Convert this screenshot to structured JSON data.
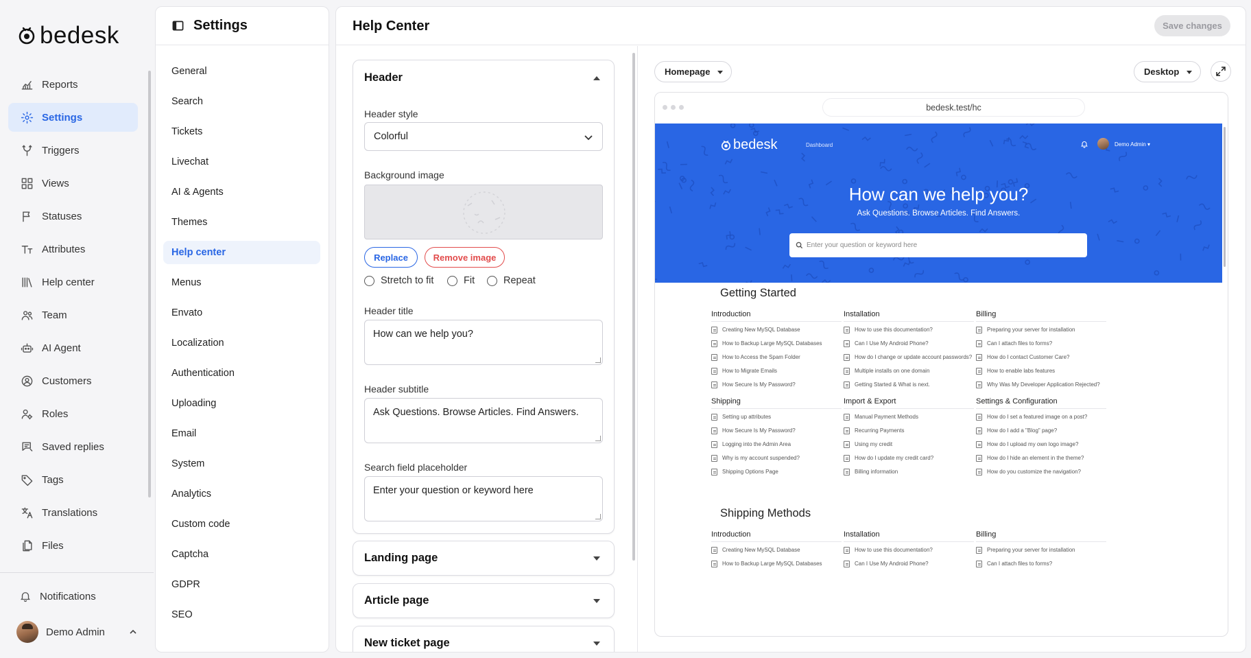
{
  "app": {
    "name": "bedesk"
  },
  "sidebar": {
    "items": [
      {
        "label": "Reports",
        "icon": "chart-icon"
      },
      {
        "label": "Settings",
        "icon": "gear-icon",
        "active": true
      },
      {
        "label": "Triggers",
        "icon": "split-icon"
      },
      {
        "label": "Views",
        "icon": "grid-icon"
      },
      {
        "label": "Statuses",
        "icon": "flag-icon"
      },
      {
        "label": "Attributes",
        "icon": "text-size-icon"
      },
      {
        "label": "Help center",
        "icon": "library-icon"
      },
      {
        "label": "Team",
        "icon": "team-icon"
      },
      {
        "label": "AI Agent",
        "icon": "robot-icon"
      },
      {
        "label": "Customers",
        "icon": "user-circle-icon"
      },
      {
        "label": "Roles",
        "icon": "user-gear-icon"
      },
      {
        "label": "Saved replies",
        "icon": "message-icon"
      },
      {
        "label": "Tags",
        "icon": "tag-icon"
      },
      {
        "label": "Translations",
        "icon": "translate-icon"
      },
      {
        "label": "Files",
        "icon": "files-icon"
      }
    ],
    "notifications": "Notifications",
    "user": "Demo Admin"
  },
  "settings": {
    "title": "Settings",
    "items": [
      "General",
      "Search",
      "Tickets",
      "Livechat",
      "AI & Agents",
      "Themes",
      "Help center",
      "Menus",
      "Envato",
      "Localization",
      "Authentication",
      "Uploading",
      "Email",
      "System",
      "Analytics",
      "Custom code",
      "Captcha",
      "GDPR",
      "SEO"
    ],
    "active": "Help center"
  },
  "main": {
    "title": "Help Center",
    "save_label": "Save changes"
  },
  "editor": {
    "header": {
      "title": "Header",
      "style_label": "Header style",
      "style_value": "Colorful",
      "bg_label": "Background image",
      "replace_label": "Replace",
      "remove_label": "Remove image",
      "fit_options": [
        "Stretch to fit",
        "Fit",
        "Repeat"
      ],
      "title_label": "Header title",
      "title_value": "How can we help you?",
      "subtitle_label": "Header subtitle",
      "subtitle_value": "Ask Questions. Browse Articles. Find Answers.",
      "placeholder_label": "Search field placeholder",
      "placeholder_value": "Enter your question or keyword here"
    },
    "collapsed": [
      "Landing page",
      "Article page",
      "New ticket page"
    ]
  },
  "preview": {
    "page_select": "Homepage",
    "device_select": "Desktop",
    "url": "bedesk.test/hc",
    "nav_link": "Dashboard",
    "user": "Demo Admin",
    "hero_title": "How can we help you?",
    "hero_subtitle": "Ask Questions. Browse Articles. Find Answers.",
    "search_placeholder": "Enter your question or keyword here",
    "accent": "#2966e4",
    "sections": [
      {
        "title": "Getting Started",
        "columns": [
          {
            "heading": "Introduction",
            "articles": [
              "Creating New MySQL Database",
              "How to Backup Large MySQL Databases",
              "How to Access the Spam Folder",
              "How to Migrate Emails",
              "How Secure Is My Password?"
            ]
          },
          {
            "heading": "Installation",
            "articles": [
              "How to use this documentation?",
              "Can I Use My Android Phone?",
              "How do I change or update account passwords?",
              "Multiple installs on one domain",
              "Getting Started & What is next."
            ]
          },
          {
            "heading": "Billing",
            "articles": [
              "Preparing your server for installation",
              "Can I attach files to forms?",
              "How do I contact Customer Care?",
              "How to enable labs features",
              "Why Was My Developer Application Rejected?"
            ]
          }
        ]
      },
      {
        "title": "",
        "columns": [
          {
            "heading": "Shipping",
            "articles": [
              "Setting up attributes",
              "How Secure Is My Password?",
              "Logging into the Admin Area",
              "Why is my account suspended?",
              "Shipping Options Page"
            ]
          },
          {
            "heading": "Import & Export",
            "articles": [
              "Manual Payment Methods",
              "Recurring Payments",
              "Using my credit",
              "How do I update my credit card?",
              "Billing information"
            ]
          },
          {
            "heading": "Settings & Configuration",
            "articles": [
              "How do I set a featured image on a post?",
              "How do I add a \"Blog\" page?",
              "How do I upload my own logo image?",
              "How do I hide an element in the theme?",
              "How do you customize the navigation?"
            ]
          }
        ]
      },
      {
        "title": "Shipping Methods",
        "columns": [
          {
            "heading": "Introduction",
            "articles": [
              "Creating New MySQL Database",
              "How to Backup Large MySQL Databases"
            ]
          },
          {
            "heading": "Installation",
            "articles": [
              "How to use this documentation?",
              "Can I Use My Android Phone?"
            ]
          },
          {
            "heading": "Billing",
            "articles": [
              "Preparing your server for installation",
              "Can I attach files to forms?"
            ]
          }
        ]
      }
    ]
  }
}
